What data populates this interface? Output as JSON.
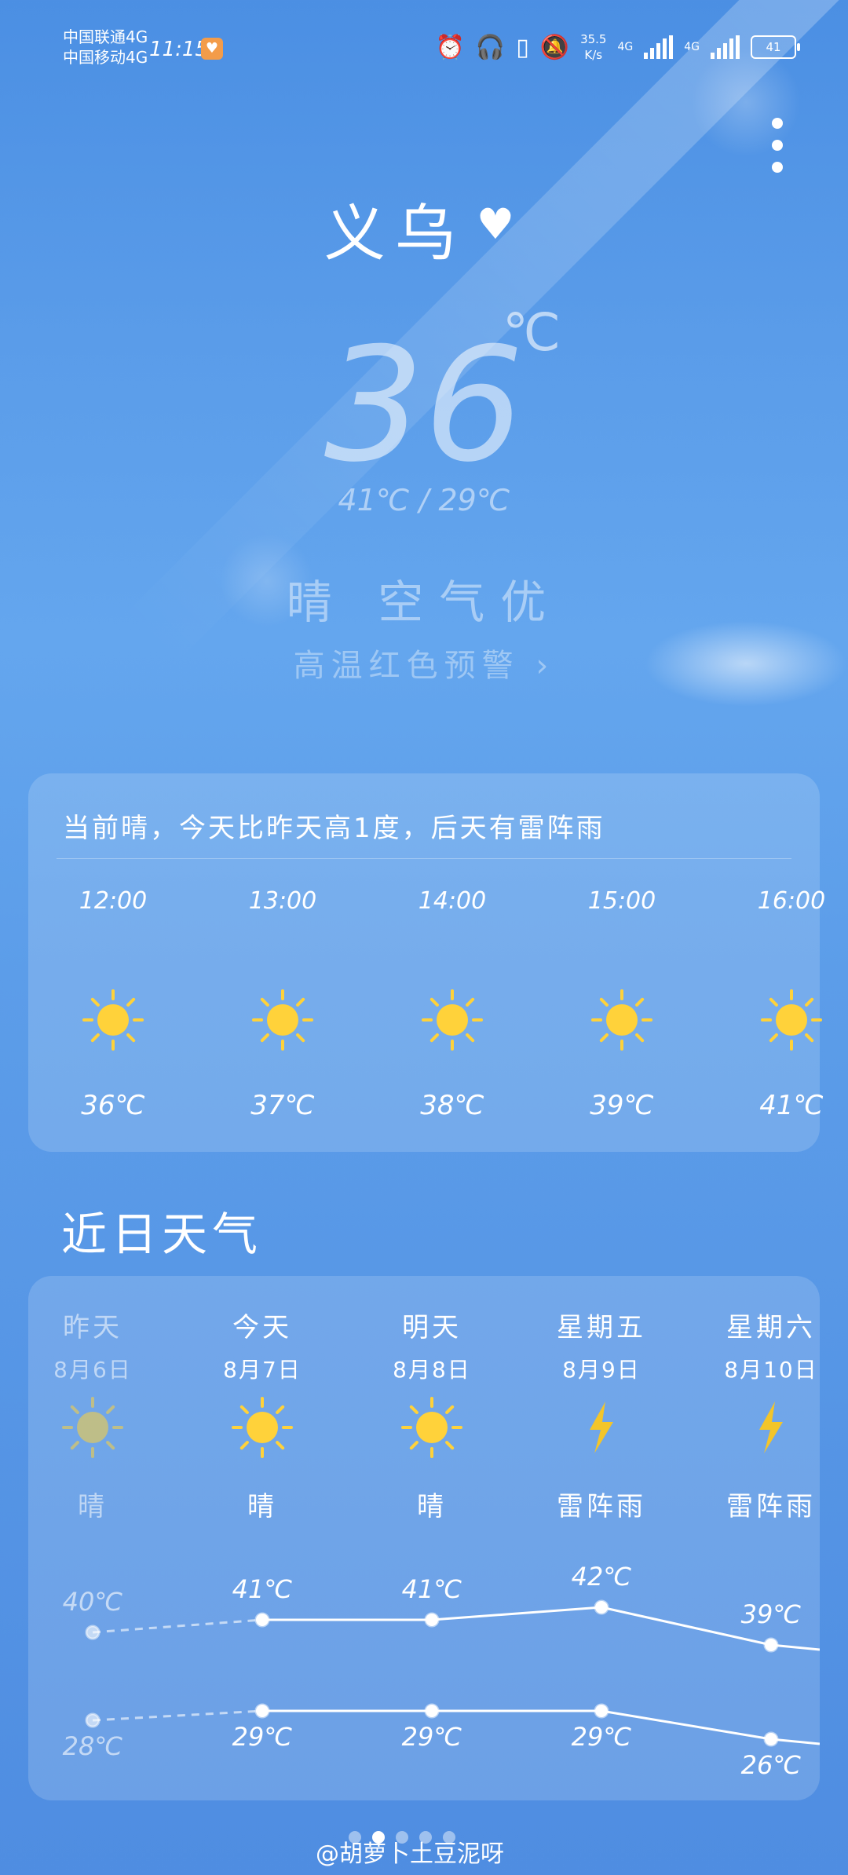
{
  "status": {
    "carrier1": "中国联通4G",
    "carrier2": "中国移动4G",
    "time": "11:15",
    "speed_value": "35.5",
    "speed_unit": "K/s",
    "net1": "4G",
    "net2": "4G",
    "battery": "41"
  },
  "location": {
    "city": "义乌"
  },
  "current": {
    "temp": "36",
    "unit": "℃",
    "high_low": "41℃ / 29℃",
    "condition": "晴 空气优",
    "alert": "高温红色预警"
  },
  "hourly": {
    "summary": "当前晴，今天比昨天高1度，后天有雷阵雨",
    "items": [
      {
        "time": "12:00",
        "icon": "sun-icon",
        "temp": "36℃"
      },
      {
        "time": "13:00",
        "icon": "sun-icon",
        "temp": "37℃"
      },
      {
        "time": "14:00",
        "icon": "sun-icon",
        "temp": "38℃"
      },
      {
        "time": "15:00",
        "icon": "sun-icon",
        "temp": "39℃"
      },
      {
        "time": "16:00",
        "icon": "sun-icon",
        "temp": "41℃"
      }
    ]
  },
  "daily": {
    "title": "近日天气",
    "days": [
      {
        "name": "昨天",
        "date": "8月6日",
        "icon": "sun-icon",
        "cond": "晴",
        "high": 40,
        "low": 28,
        "high_label": "40℃",
        "low_label": "28℃"
      },
      {
        "name": "今天",
        "date": "8月7日",
        "icon": "sun-icon",
        "cond": "晴",
        "high": 41,
        "low": 29,
        "high_label": "41℃",
        "low_label": "29℃"
      },
      {
        "name": "明天",
        "date": "8月8日",
        "icon": "sun-icon",
        "cond": "晴",
        "high": 41,
        "low": 29,
        "high_label": "41℃",
        "low_label": "29℃"
      },
      {
        "name": "星期五",
        "date": "8月9日",
        "icon": "lightning-icon",
        "cond": "雷阵雨",
        "high": 42,
        "low": 29,
        "high_label": "42℃",
        "low_label": "29℃"
      },
      {
        "name": "星期六",
        "date": "8月10日",
        "icon": "lightning-icon",
        "cond": "雷阵雨",
        "high": 39,
        "low": 26,
        "high_label": "39℃",
        "low_label": "26℃"
      }
    ]
  },
  "watermark": "@胡萝卜土豆泥呀",
  "colors": {
    "sun": "#ffd23a",
    "lightning": "#f3c52a",
    "sky_top": "#4b8fe3"
  }
}
